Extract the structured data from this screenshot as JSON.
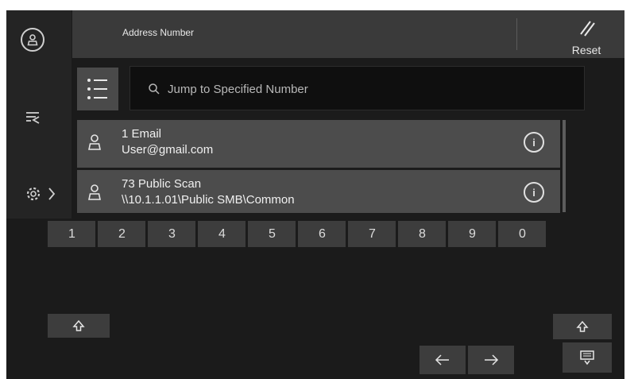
{
  "header": {
    "title": "Address Number",
    "reset_label": "Reset"
  },
  "search": {
    "placeholder": "Jump to Specified Number"
  },
  "entries": [
    {
      "name": "1 Email",
      "address": "User@gmail.com"
    },
    {
      "name": "73 Public Scan",
      "address": "\\\\10.1.1.01\\Public  SMB\\Common"
    }
  ],
  "keypad": {
    "digits": [
      "1",
      "2",
      "3",
      "4",
      "5",
      "6",
      "7",
      "8",
      "9",
      "0"
    ]
  },
  "icons": {
    "rail": [
      "user-icon",
      "address-transfer-icon",
      "gear-icon",
      "chevron-right-icon"
    ],
    "keys": [
      "shift-up-icon",
      "arrow-left-icon",
      "arrow-right-icon",
      "shift-up-icon",
      "keyboard-hide-icon"
    ]
  },
  "colors": {
    "background": "#1b1b1b",
    "header": "#3a3a3a",
    "list_row": "#4c4c4c",
    "key": "#3d3d3d",
    "text": "#f0f0f0"
  }
}
